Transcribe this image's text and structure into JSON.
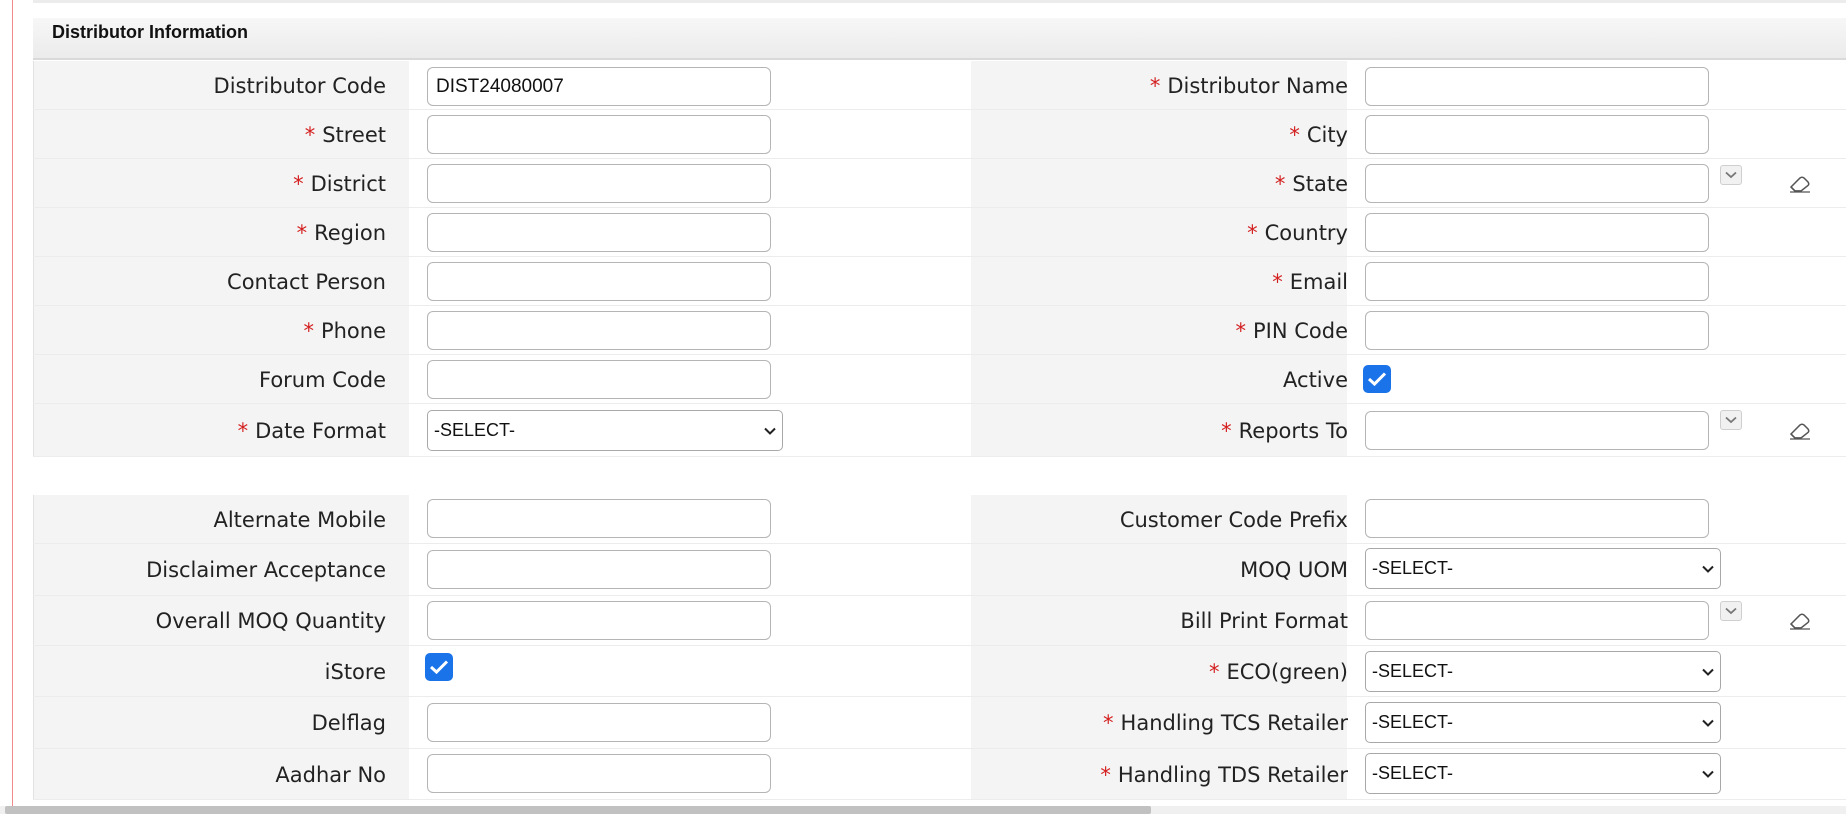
{
  "section": {
    "title": "Distributor Information"
  },
  "fields": {
    "distributor_code": {
      "label": "Distributor Code",
      "value": "DIST24080007"
    },
    "distributor_name": {
      "label": "Distributor Name",
      "value": ""
    },
    "street": {
      "label": "Street",
      "value": ""
    },
    "city": {
      "label": "City",
      "value": ""
    },
    "district": {
      "label": "District",
      "value": ""
    },
    "state": {
      "label": "State",
      "value": ""
    },
    "region": {
      "label": "Region",
      "value": ""
    },
    "country": {
      "label": "Country",
      "value": ""
    },
    "contact_person": {
      "label": "Contact Person",
      "value": ""
    },
    "email": {
      "label": "Email",
      "value": ""
    },
    "phone": {
      "label": "Phone",
      "value": ""
    },
    "pin_code": {
      "label": "PIN Code",
      "value": ""
    },
    "forum_code": {
      "label": "Forum Code",
      "value": ""
    },
    "active": {
      "label": "Active",
      "checked": true
    },
    "date_format": {
      "label": "Date Format",
      "selected": "-SELECT-"
    },
    "reports_to": {
      "label": "Reports To",
      "value": ""
    },
    "alternate_mobile": {
      "label": "Alternate Mobile",
      "value": ""
    },
    "customer_code_prefix": {
      "label": "Customer Code Prefix",
      "value": ""
    },
    "disclaimer_acceptance": {
      "label": "Disclaimer Acceptance",
      "value": ""
    },
    "moq_uom": {
      "label": "MOQ UOM",
      "selected": "-SELECT-"
    },
    "overall_moq_quantity": {
      "label": "Overall MOQ Quantity",
      "value": ""
    },
    "bill_print_format": {
      "label": "Bill Print Format",
      "value": ""
    },
    "istore": {
      "label": "iStore",
      "checked": true
    },
    "eco_green": {
      "label": "ECO(green)",
      "selected": "-SELECT-"
    },
    "delflag": {
      "label": "Delflag",
      "value": ""
    },
    "handling_tcs_retailer": {
      "label": "Handling TCS Retailer",
      "selected": "-SELECT-"
    },
    "aadhar_no": {
      "label": "Aadhar No",
      "value": ""
    },
    "handling_tds_retailer": {
      "label": "Handling TDS Retailer",
      "selected": "-SELECT-"
    }
  },
  "required_mark": "*",
  "colors": {
    "required": "#d42020",
    "checkbox": "#1a73e8",
    "label_bg": "#f4f4f4"
  },
  "icons": {
    "lookup": "chevron-down-icon",
    "clear": "eraser-icon",
    "check": "checkmark-icon"
  }
}
